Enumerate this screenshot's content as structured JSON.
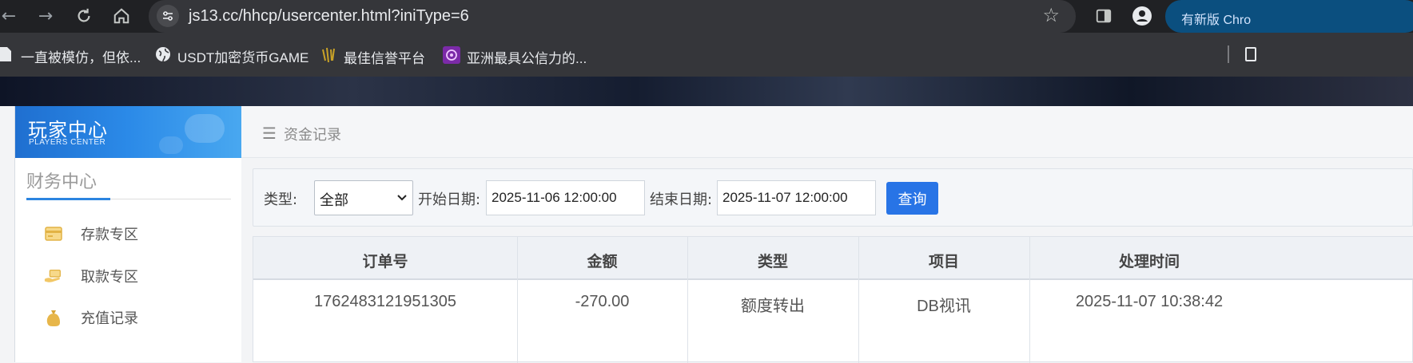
{
  "browser": {
    "url": "js13.cc/hhcp/usercenter.html?iniType=6",
    "update_button": "有新版 Chro",
    "bookmarks": [
      {
        "label": "一直被模仿，但依...",
        "icon": "page-icon"
      },
      {
        "label": "USDT加密货币GAME",
        "icon": "globe-icon"
      },
      {
        "label": "最佳信誉平台",
        "icon": "gold-logo-icon"
      },
      {
        "label": "亚洲最具公信力的...",
        "icon": "purple-logo-icon"
      }
    ]
  },
  "sidebar": {
    "brand_title": "玩家中心",
    "brand_subtitle": "PLAYERS CENTER",
    "section_title": "财务中心",
    "items": [
      {
        "label": "存款专区",
        "icon": "deposit-card-icon"
      },
      {
        "label": "取款专区",
        "icon": "withdraw-hand-icon"
      },
      {
        "label": "充值记录",
        "icon": "money-bag-icon"
      }
    ]
  },
  "breadcrumb": {
    "title": "资金记录"
  },
  "filter": {
    "type_label": "类型:",
    "type_value": "全部",
    "start_label": "开始日期:",
    "start_value": "2025-11-06 12:00:00",
    "end_label": "结束日期:",
    "end_value": "2025-11-07 12:00:00",
    "query_button": "查询"
  },
  "table": {
    "headers": [
      "订单号",
      "金额",
      "类型",
      "项目",
      "处理时间"
    ],
    "rows": [
      [
        "1762483121951305",
        "-270.00",
        "额度转出",
        "DB视讯",
        "2025-11-07 10:38:42"
      ]
    ]
  },
  "colors": {
    "accent": "#2874e6",
    "chrome_dark": "#202124",
    "update_button": "#0b4f7f"
  }
}
